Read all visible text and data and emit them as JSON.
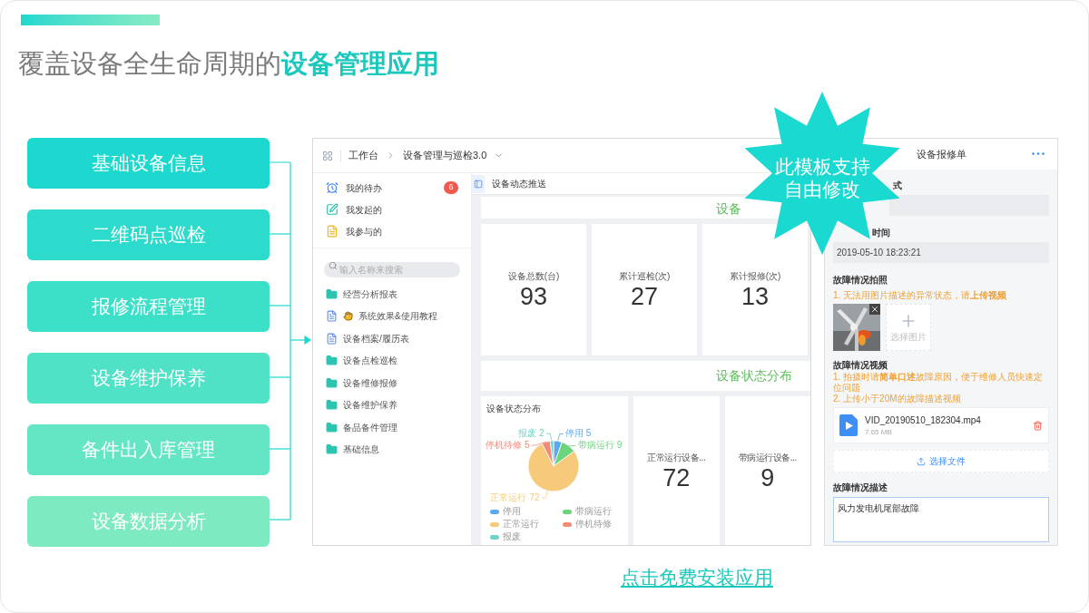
{
  "title": {
    "text": "覆盖设备全生命周期的",
    "highlight": "设备管理应用"
  },
  "features": [
    {
      "label": "基础设备信息"
    },
    {
      "label": "二维码点巡检"
    },
    {
      "label": "报修流程管理"
    },
    {
      "label": "设备维护保养"
    },
    {
      "label": "备件出入库管理"
    },
    {
      "label": "设备数据分析"
    }
  ],
  "app_window": {
    "breadcrumb": [
      "工作台",
      "设备管理与巡检3.0"
    ],
    "sidebar": {
      "quick_items": [
        {
          "kind": "alarm",
          "label": "我的待办",
          "badge": "6"
        },
        {
          "kind": "edit",
          "label": "我发起的"
        },
        {
          "kind": "task",
          "label": "我参与的"
        }
      ],
      "search": {
        "placeholder": "输入名称来搜索"
      },
      "items": [
        {
          "kind": "folder",
          "label": "经营分析报表"
        },
        {
          "kind": "guide",
          "label": "系统效果&使用教程"
        },
        {
          "kind": "file",
          "label": "设备档案/履历表"
        },
        {
          "kind": "folder",
          "label": "设备点检巡检"
        },
        {
          "kind": "folder",
          "label": "设备维修报修"
        },
        {
          "kind": "folder",
          "label": "设备维护保养"
        },
        {
          "kind": "folder",
          "label": "备品备件管理"
        },
        {
          "kind": "folder",
          "label": "基础信息"
        }
      ]
    },
    "tab": {
      "label": "设备动态推送",
      "selected": true
    },
    "section_1_title": "设备",
    "stats": [
      {
        "label": "设备总数(台)",
        "value": "93"
      },
      {
        "label": "累计巡检(次)",
        "value": "27"
      },
      {
        "label": "累计报修(次)",
        "value": "13"
      }
    ],
    "section_2_title": "设备状态分布",
    "pie_card": {
      "title": "设备状态分布",
      "chart_data": {
        "type": "pie",
        "categories": [
          "停用",
          "带病运行",
          "正常运行",
          "停机待修",
          "报废"
        ],
        "values": [
          5,
          9,
          72,
          5,
          2
        ],
        "colors": [
          "#5aa9f0",
          "#6dd47e",
          "#f7c97a",
          "#f28b7b",
          "#6fd3c9"
        ],
        "data_labels": true,
        "legend": true
      }
    },
    "status_stats": [
      {
        "label": "正常运行设备...",
        "value": "72"
      },
      {
        "label": "带病运行设备...",
        "value": "9"
      }
    ]
  },
  "repair_form": {
    "title": "设备报修单",
    "field_1": {
      "label": "式"
    },
    "field_2": {
      "label": "时间",
      "value": "2019-05-10 18:23:21"
    },
    "photos": {
      "label": "故障情况拍照",
      "hint": "1. 无法用图片描述的异常状态，请**上传视频**",
      "add_label": "选择图片"
    },
    "video": {
      "label": "故障情况视频",
      "hints": [
        "1. 拍摄时请**简单口述**故障原因，便于维修人员快速定位问题",
        "2. 上传小于20M的故障描述视频"
      ],
      "file_name": "VID_20190510_182304.mp4",
      "file_size": "7.65 MB",
      "upload_label": "选择文件"
    },
    "description": {
      "label": "故障情况描述",
      "value": "风力发电机尾部故障"
    }
  },
  "badge": {
    "lines": [
      "此模板支持",
      "自由修改"
    ]
  },
  "link": "点击免费安装应用"
}
